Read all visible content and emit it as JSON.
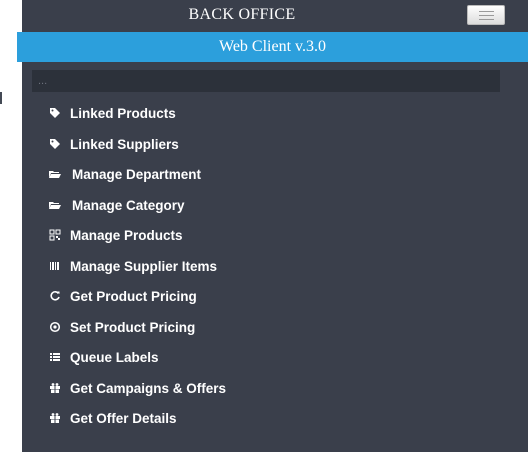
{
  "header": {
    "title": "BACK OFFICE",
    "version": "Web Client v.3.0"
  },
  "search": {
    "placeholder": "..."
  },
  "colors": {
    "panel": "#3a3f4b",
    "accent": "#2c9fdc",
    "search_bg": "#2c313a"
  },
  "nav": {
    "items": [
      {
        "label": "Linked Products",
        "icon": "tag-icon"
      },
      {
        "label": "Linked Suppliers",
        "icon": "tag-icon"
      },
      {
        "label": "Manage Department",
        "icon": "folder-open-icon"
      },
      {
        "label": "Manage Category",
        "icon": "folder-open-icon"
      },
      {
        "label": "Manage Products",
        "icon": "qrcode-icon"
      },
      {
        "label": "Manage Supplier Items",
        "icon": "barcode-icon"
      },
      {
        "label": "Get Product Pricing",
        "icon": "refresh-icon"
      },
      {
        "label": "Set Product Pricing",
        "icon": "record-icon"
      },
      {
        "label": "Queue Labels",
        "icon": "list-icon"
      },
      {
        "label": "Get Campaigns & Offers",
        "icon": "gift-icon"
      },
      {
        "label": "Get Offer Details",
        "icon": "gift-icon"
      }
    ]
  }
}
